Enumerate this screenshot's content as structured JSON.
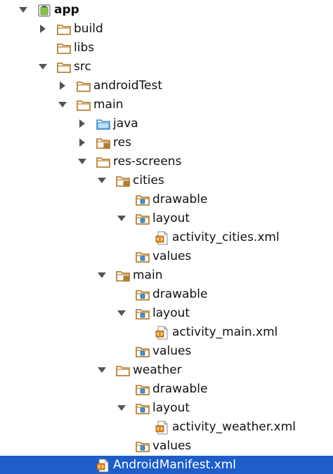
{
  "project_tree": {
    "items": [
      {
        "label": "app",
        "icon": "android-module-icon",
        "expander": "expanded"
      },
      {
        "label": "build",
        "icon": "folder-icon",
        "expander": "collapsed"
      },
      {
        "label": "libs",
        "icon": "folder-icon",
        "expander": "none"
      },
      {
        "label": "src",
        "icon": "folder-icon",
        "expander": "expanded"
      },
      {
        "label": "androidTest",
        "icon": "folder-icon",
        "expander": "collapsed"
      },
      {
        "label": "main",
        "icon": "folder-icon",
        "expander": "expanded"
      },
      {
        "label": "java",
        "icon": "source-folder-icon",
        "expander": "collapsed"
      },
      {
        "label": "res",
        "icon": "resource-folder-icon",
        "expander": "collapsed"
      },
      {
        "label": "res-screens",
        "icon": "folder-icon",
        "expander": "expanded"
      },
      {
        "label": "cities",
        "icon": "resource-folder-icon",
        "expander": "expanded"
      },
      {
        "label": "drawable",
        "icon": "resource-subfolder-icon",
        "expander": "none"
      },
      {
        "label": "layout",
        "icon": "resource-subfolder-icon",
        "expander": "expanded"
      },
      {
        "label": "activity_cities.xml",
        "icon": "xml-file-icon",
        "expander": "none"
      },
      {
        "label": "values",
        "icon": "resource-subfolder-icon",
        "expander": "none"
      },
      {
        "label": "main",
        "icon": "resource-folder-icon",
        "expander": "expanded"
      },
      {
        "label": "drawable",
        "icon": "resource-subfolder-icon",
        "expander": "none"
      },
      {
        "label": "layout",
        "icon": "resource-subfolder-icon",
        "expander": "expanded"
      },
      {
        "label": "activity_main.xml",
        "icon": "xml-file-icon",
        "expander": "none"
      },
      {
        "label": "values",
        "icon": "resource-subfolder-icon",
        "expander": "none"
      },
      {
        "label": "weather",
        "icon": "folder-icon",
        "expander": "expanded"
      },
      {
        "label": "drawable",
        "icon": "resource-subfolder-icon",
        "expander": "none"
      },
      {
        "label": "layout",
        "icon": "resource-subfolder-icon",
        "expander": "expanded"
      },
      {
        "label": "activity_weather.xml",
        "icon": "xml-file-icon",
        "expander": "none"
      },
      {
        "label": "values",
        "icon": "resource-subfolder-icon",
        "expander": "none"
      },
      {
        "label": "AndroidManifest.xml",
        "icon": "manifest-file-icon",
        "expander": "none",
        "selected": true
      }
    ]
  },
  "colors": {
    "selection": "#1e5ec9",
    "folder": "#b8833a",
    "source_folder": "#4a90c8",
    "resource_badge": "#d9a64a",
    "xml_badge": "#e08a1e",
    "android_green": "#8bc34a",
    "arrow": "#555555"
  }
}
